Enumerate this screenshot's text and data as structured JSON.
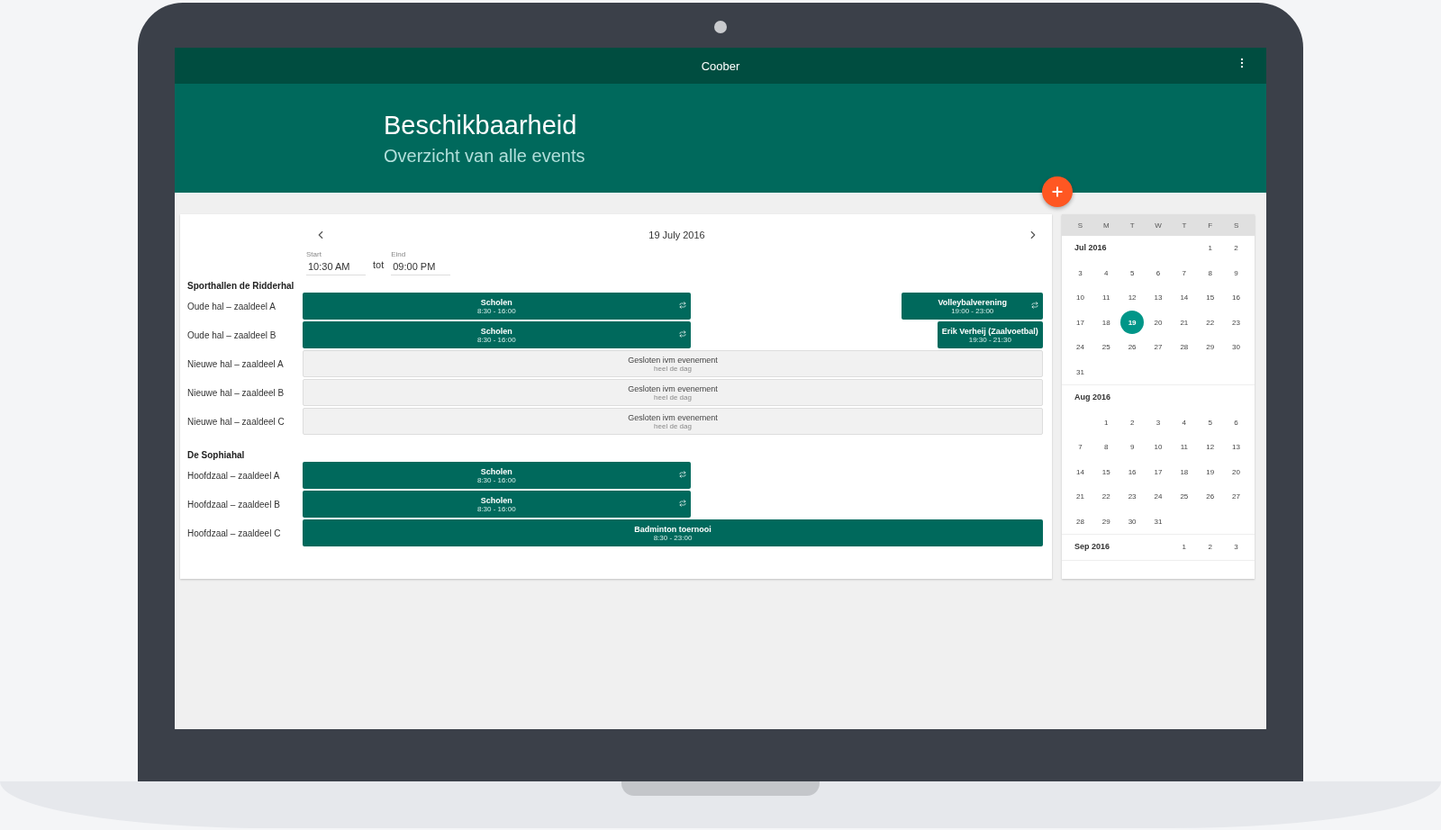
{
  "app_bar": {
    "title": "Coober"
  },
  "header": {
    "title": "Beschikbaarheid",
    "subtitle": "Overzicht van alle events"
  },
  "day_view": {
    "date": "19 July 2016",
    "start": {
      "label": "Start",
      "value": "10:30 AM"
    },
    "separator": "tot",
    "end": {
      "label": "Eind",
      "value": "09:00 PM"
    },
    "groups": [
      {
        "name": "Sporthallen de Ridderhal",
        "rooms": [
          {
            "name": "Oude hal – zaaldeel A",
            "events": [
              {
                "kind": "booking",
                "title": "Scholen",
                "time": "8:30 - 16:00",
                "recurring": true
              },
              {
                "kind": "booking",
                "title": "Volleybalverening",
                "time": "19:00 - 23:00",
                "recurring": true
              }
            ]
          },
          {
            "name": "Oude hal – zaaldeel B",
            "events": [
              {
                "kind": "booking",
                "title": "Scholen",
                "time": "8:30 - 16:00",
                "recurring": true
              },
              {
                "kind": "booking",
                "title": "Erik Verheij (Zaalvoetbal)",
                "time": "19:30 - 21:30",
                "recurring": false
              }
            ]
          },
          {
            "name": "Nieuwe hal – zaaldeel A",
            "events": [
              {
                "kind": "closed",
                "title": "Gesloten ivm evenement",
                "time": "heel de dag",
                "recurring": false
              }
            ]
          },
          {
            "name": "Nieuwe hal – zaaldeel B",
            "events": [
              {
                "kind": "closed",
                "title": "Gesloten ivm evenement",
                "time": "heel de dag",
                "recurring": false
              }
            ]
          },
          {
            "name": "Nieuwe hal – zaaldeel C",
            "events": [
              {
                "kind": "closed",
                "title": "Gesloten ivm evenement",
                "time": "heel de dag",
                "recurring": false
              }
            ]
          }
        ]
      },
      {
        "name": "De Sophiahal",
        "rooms": [
          {
            "name": "Hoofdzaal – zaaldeel A",
            "events": [
              {
                "kind": "booking",
                "title": "Scholen",
                "time": "8:30 - 16:00",
                "recurring": true
              }
            ]
          },
          {
            "name": "Hoofdzaal – zaaldeel B",
            "events": [
              {
                "kind": "booking",
                "title": "Scholen",
                "time": "8:30 - 16:00",
                "recurring": true
              }
            ]
          },
          {
            "name": "Hoofdzaal – zaaldeel C",
            "events": [
              {
                "kind": "booking",
                "title": "Badminton toernooi",
                "time": "8:30 - 23:00",
                "recurring": false
              }
            ]
          }
        ]
      }
    ]
  },
  "calendar": {
    "weekdays": [
      "S",
      "M",
      "T",
      "W",
      "T",
      "F",
      "S"
    ],
    "months": [
      {
        "name": "Jul 2016",
        "weeks": [
          [
            {
              "day": "1",
              "selected": false
            },
            {
              "day": "2",
              "selected": false
            }
          ],
          [
            {
              "day": "3",
              "selected": false
            },
            {
              "day": "4",
              "selected": false
            },
            {
              "day": "5",
              "selected": false
            },
            {
              "day": "6",
              "selected": false
            },
            {
              "day": "7",
              "selected": false
            },
            {
              "day": "8",
              "selected": false
            },
            {
              "day": "9",
              "selected": false
            }
          ],
          [
            {
              "day": "10",
              "selected": false
            },
            {
              "day": "11",
              "selected": false
            },
            {
              "day": "12",
              "selected": false
            },
            {
              "day": "13",
              "selected": false
            },
            {
              "day": "14",
              "selected": false
            },
            {
              "day": "15",
              "selected": false
            },
            {
              "day": "16",
              "selected": false
            }
          ],
          [
            {
              "day": "17",
              "selected": false
            },
            {
              "day": "18",
              "selected": false
            },
            {
              "day": "19",
              "selected": true
            },
            {
              "day": "20",
              "selected": false
            },
            {
              "day": "21",
              "selected": false
            },
            {
              "day": "22",
              "selected": false
            },
            {
              "day": "23",
              "selected": false
            }
          ],
          [
            {
              "day": "24",
              "selected": false
            },
            {
              "day": "25",
              "selected": false
            },
            {
              "day": "26",
              "selected": false
            },
            {
              "day": "27",
              "selected": false
            },
            {
              "day": "28",
              "selected": false
            },
            {
              "day": "29",
              "selected": false
            },
            {
              "day": "30",
              "selected": false
            }
          ],
          [
            {
              "day": "31",
              "selected": false
            }
          ]
        ]
      },
      {
        "name": "Aug 2016",
        "weeks": [
          [
            {
              "day": "1",
              "selected": false
            },
            {
              "day": "2",
              "selected": false
            },
            {
              "day": "3",
              "selected": false
            },
            {
              "day": "4",
              "selected": false
            },
            {
              "day": "5",
              "selected": false
            },
            {
              "day": "6",
              "selected": false
            }
          ],
          [
            {
              "day": "7",
              "selected": false
            },
            {
              "day": "8",
              "selected": false
            },
            {
              "day": "9",
              "selected": false
            },
            {
              "day": "10",
              "selected": false
            },
            {
              "day": "11",
              "selected": false
            },
            {
              "day": "12",
              "selected": false
            },
            {
              "day": "13",
              "selected": false
            }
          ],
          [
            {
              "day": "14",
              "selected": false
            },
            {
              "day": "15",
              "selected": false
            },
            {
              "day": "16",
              "selected": false
            },
            {
              "day": "17",
              "selected": false
            },
            {
              "day": "18",
              "selected": false
            },
            {
              "day": "19",
              "selected": false
            },
            {
              "day": "20",
              "selected": false
            }
          ],
          [
            {
              "day": "21",
              "selected": false
            },
            {
              "day": "22",
              "selected": false
            },
            {
              "day": "23",
              "selected": false
            },
            {
              "day": "24",
              "selected": false
            },
            {
              "day": "25",
              "selected": false
            },
            {
              "day": "26",
              "selected": false
            },
            {
              "day": "27",
              "selected": false
            }
          ],
          [
            {
              "day": "28",
              "selected": false
            },
            {
              "day": "29",
              "selected": false
            },
            {
              "day": "30",
              "selected": false
            },
            {
              "day": "31",
              "selected": false
            }
          ]
        ]
      },
      {
        "name": "Sep 2016",
        "weeks": [
          [
            {
              "day": "1",
              "selected": false
            },
            {
              "day": "2",
              "selected": false
            },
            {
              "day": "3",
              "selected": false
            }
          ]
        ]
      }
    ]
  }
}
